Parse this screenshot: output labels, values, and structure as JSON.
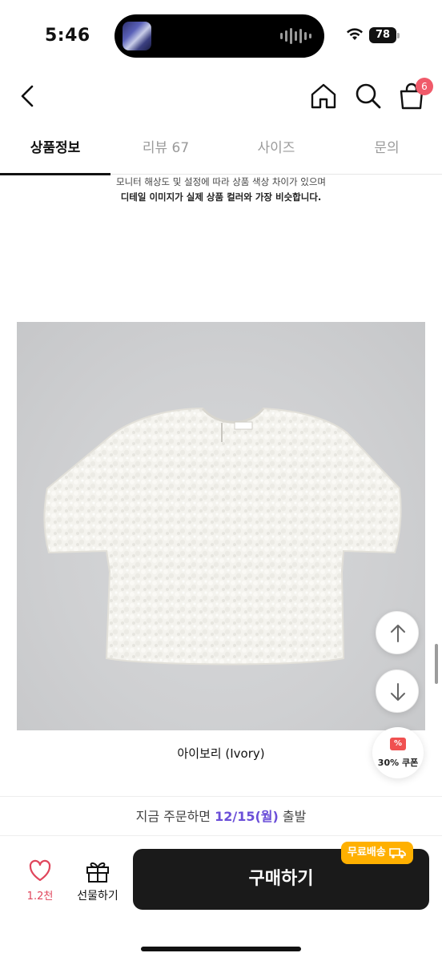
{
  "status_bar": {
    "time": "5:46",
    "battery": "78",
    "icons": [
      "wifi-icon",
      "battery-icon",
      "now-playing-waveform-icon"
    ]
  },
  "nav": {
    "icons": [
      "back-chevron-icon",
      "home-icon",
      "search-icon",
      "cart-icon"
    ],
    "cart_badge": "6"
  },
  "tabs": [
    {
      "label": "상품정보",
      "active": true
    },
    {
      "label": "리뷰 67",
      "active": false
    },
    {
      "label": "사이즈",
      "active": false
    },
    {
      "label": "문의",
      "active": false
    }
  ],
  "notice": {
    "line1": "모니터 해상도 및 설정에 따라 상품 색상 차이가 있으며",
    "line2": "디테일 이미지가 실제 상품 컬러와 가장 비슷합니다."
  },
  "product": {
    "caption": "아이보리  (Ivory)",
    "image_subject": "ivory boucle short-sleeve cropped top"
  },
  "floating": {
    "up_icon": "arrow-up-icon",
    "down_icon": "arrow-down-icon",
    "coupon_label": "30% 쿠폰"
  },
  "shipping": {
    "prefix": "지금 주문하면 ",
    "date": "12/15(월)",
    "suffix": " 출발"
  },
  "bottom_bar": {
    "like_count": "1.2천",
    "gift_label": "선물하기",
    "buy_label": "구매하기",
    "free_ship_badge": "무료배송"
  },
  "colors": {
    "accent_purple": "#6b4fd8",
    "like_red": "#e0465c",
    "badge_pink": "#f05a6a",
    "free_ship_yellow": "#ffb000",
    "buy_button": "#1a1a1a"
  }
}
